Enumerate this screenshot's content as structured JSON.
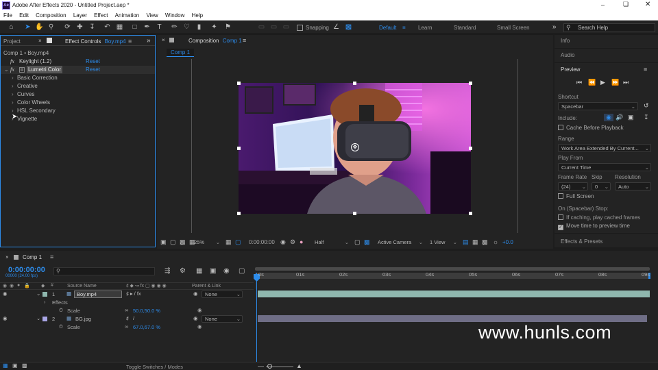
{
  "app": {
    "title": "Adobe After Effects 2020 - Untitled Project.aep *",
    "logo_text": "Ae",
    "window_controls": [
      "minimize-icon",
      "maximize-icon",
      "close-icon"
    ]
  },
  "menu": [
    "File",
    "Edit",
    "Composition",
    "Layer",
    "Effect",
    "Animation",
    "View",
    "Window",
    "Help"
  ],
  "toolbar": {
    "snapping_label": "Snapping",
    "workspaces": [
      "Default",
      "Learn",
      "Standard",
      "Small Screen"
    ],
    "active_workspace": "Default",
    "search_placeholder": "Search Help"
  },
  "left_panel": {
    "tab_project": "Project",
    "tab_effect_controls": "Effect Controls",
    "effect_controls_layer": "Boy.mp4",
    "breadcrumb": "Comp 1 • Boy.mp4",
    "effects": [
      {
        "name": "Keylight (1.2)",
        "reset": "Reset"
      },
      {
        "name": "Lumetri Color",
        "reset": "Reset"
      }
    ],
    "lumetri_sections": [
      "Basic Correction",
      "Creative",
      "Curves",
      "Color Wheels",
      "HSL Secondary",
      "Vignette"
    ]
  },
  "composition": {
    "panel_label": "Composition",
    "comp_name": "Comp 1",
    "tab": "Comp 1",
    "zoom": "25%",
    "timecode": "0:00:00:00",
    "resolution": "Half",
    "camera": "Active Camera",
    "views": "1 View",
    "exposure": "+0.0"
  },
  "right_panel": {
    "info": "Info",
    "audio": "Audio",
    "preview": "Preview",
    "shortcut_label": "Shortcut",
    "shortcut_value": "Spacebar",
    "include_label": "Include:",
    "cache_before_playback": "Cache Before Playback",
    "range_label": "Range",
    "range_value": "Work Area Extended By Current...",
    "play_from_label": "Play From",
    "play_from_value": "Current Time",
    "frame_rate_label": "Frame Rate",
    "skip_label": "Skip",
    "resolution_label": "Resolution",
    "frame_rate_value": "(24)",
    "skip_value": "0",
    "resolution_value": "Auto",
    "full_screen": "Full Screen",
    "on_stop_label": "On (Spacebar) Stop:",
    "if_caching": "If caching, play cached frames",
    "move_time": "Move time to preview time",
    "effects_presets": "Effects & Presets"
  },
  "timeline": {
    "tab": "Comp 1",
    "timecode": "0:00:00:00",
    "timecode_sub": "00000 (24.00 fps)",
    "col_source_name": "Source Name",
    "col_parent": "Parent & Link",
    "layers": [
      {
        "num": "1",
        "name": "Boy.mp4",
        "parent": "None",
        "effects_label": "Effects",
        "prop": "Scale",
        "prop_value": "50.0,50.0 %"
      },
      {
        "num": "2",
        "name": "BG.jpg",
        "parent": "None",
        "prop": "Scale",
        "prop_value": "67.0,67.0 %"
      }
    ],
    "ruler": [
      "0s",
      "01s",
      "02s",
      "03s",
      "04s",
      "05s",
      "06s",
      "07s",
      "08s",
      "09s"
    ],
    "toggle_label": "Toggle Switches / Modes"
  },
  "watermark": "www.hunls.com",
  "colors": {
    "accent_blue": "#2d8ceb",
    "track_teal": "#8fb7ae",
    "track_purple": "#6f6e86",
    "panel_bg": "#232323"
  }
}
